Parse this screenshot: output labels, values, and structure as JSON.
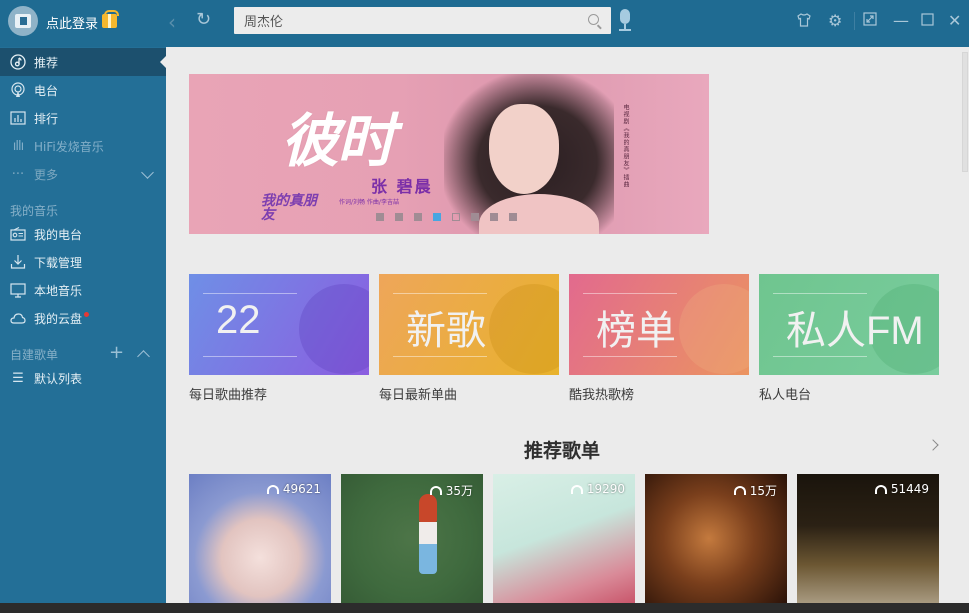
{
  "titlebar": {
    "login_label": "点此登录",
    "search_value": "周杰伦",
    "icons": [
      "back-icon",
      "refresh-icon",
      "search-icon",
      "mic-icon",
      "skin-icon",
      "settings-icon",
      "mini-mode-icon",
      "minimize-icon",
      "maximize-icon",
      "close-icon"
    ],
    "back_glyph": "‹",
    "refresh_glyph": "↻",
    "skin_glyph": "👕",
    "settings_glyph": "⚙",
    "mini_glyph": "⤢",
    "minimize_glyph": "—",
    "maximize_glyph": "☐",
    "close_glyph": "✕"
  },
  "sidebar": {
    "nav": [
      {
        "label": "推荐",
        "icon": "music-note-icon",
        "glyph": "♪",
        "active": true
      },
      {
        "label": "电台",
        "icon": "radio-icon",
        "glyph": "◉"
      },
      {
        "label": "排行",
        "icon": "chart-icon",
        "glyph": "▥"
      },
      {
        "label": "HiFi发烧音乐",
        "icon": "soundwave-icon",
        "glyph": "ıllı"
      },
      {
        "label": "更多",
        "icon": "more-dots-icon",
        "glyph": "···"
      }
    ],
    "my_music_title": "我的音乐",
    "my_music": [
      {
        "label": "我的电台",
        "icon": "my-radio-icon",
        "glyph": "▭"
      },
      {
        "label": "下载管理",
        "icon": "download-icon",
        "glyph": "⤓"
      },
      {
        "label": "本地音乐",
        "icon": "monitor-icon",
        "glyph": "▢"
      },
      {
        "label": "我的云盘",
        "icon": "cloud-icon",
        "glyph": "☁",
        "badge": true
      }
    ],
    "playlists_title": "自建歌单",
    "playlists": [
      {
        "label": "默认列表",
        "icon": "list-icon",
        "glyph": "☰"
      }
    ],
    "plus_glyph": "+"
  },
  "banner": {
    "title": "彼时",
    "artist": "张 碧晨",
    "credits": "作词/刘畅  作曲/李吉喆",
    "show": "我的真朋友",
    "vertical_text": "电视剧《我的真朋友》插曲",
    "slide_count": 8,
    "active_slide": 4
  },
  "categories": [
    {
      "big": "22",
      "label": "每日歌曲推荐",
      "color_from": "#6f8fe6",
      "color_to": "#8b5de0"
    },
    {
      "big": "新歌",
      "label": "每日最新单曲",
      "color_from": "#eea65a",
      "color_to": "#e8b22c"
    },
    {
      "big": "榜单",
      "label": "酷我热歌榜",
      "color_from": "#e26a8e",
      "color_to": "#eb9460"
    },
    {
      "big": "私人FM",
      "label": "私人电台",
      "color_from": "#6fc58f",
      "color_to": "#79cc9d"
    }
  ],
  "recommended": {
    "title": "推荐歌单",
    "playlists": [
      {
        "count": "49621"
      },
      {
        "count": "35万"
      },
      {
        "count": "19290"
      },
      {
        "count": "15万"
      },
      {
        "count": "51449"
      }
    ]
  }
}
